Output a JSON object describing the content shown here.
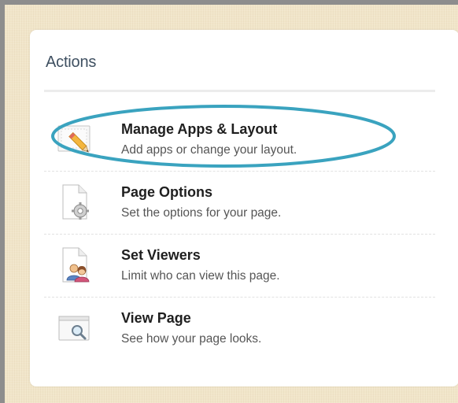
{
  "panel": {
    "title": "Actions"
  },
  "actions": [
    {
      "title": "Manage Apps & Layout",
      "description": "Add apps or change your layout.",
      "icon": "layout-pencil-icon",
      "highlighted": true
    },
    {
      "title": "Page Options",
      "description": "Set the options for your page.",
      "icon": "page-gear-icon"
    },
    {
      "title": "Set Viewers",
      "description": "Limit who can view this page.",
      "icon": "page-users-icon"
    },
    {
      "title": "View Page",
      "description": "See how your page looks.",
      "icon": "window-magnifier-icon"
    }
  ],
  "colors": {
    "highlight_ring": "#3aa3bf",
    "background": "#f1e5c9",
    "title": "#3f5061"
  }
}
